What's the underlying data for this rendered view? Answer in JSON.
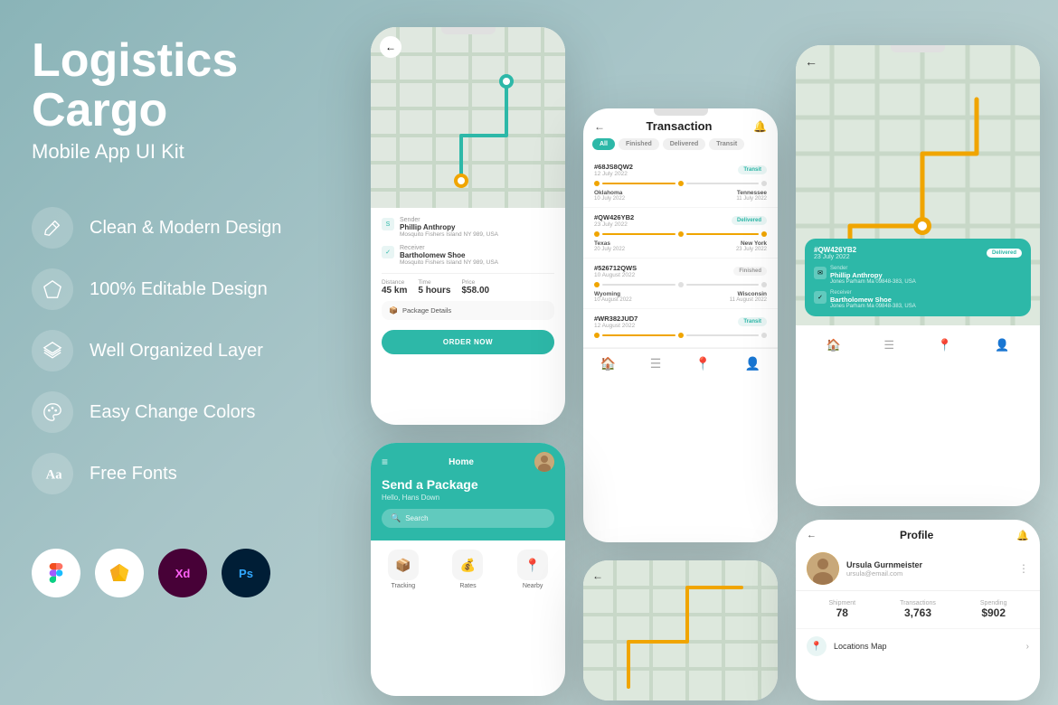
{
  "app": {
    "title": "Logistics",
    "title2": "Cargo",
    "subtitle": "Mobile App UI Kit"
  },
  "features": [
    {
      "id": "clean-design",
      "label": "Clean & Modern Design",
      "icon": "wand"
    },
    {
      "id": "editable",
      "label": "100% Editable Design",
      "icon": "diamond"
    },
    {
      "id": "layers",
      "label": "Well Organized Layer",
      "icon": "layers"
    },
    {
      "id": "colors",
      "label": "Easy Change Colors",
      "icon": "palette"
    },
    {
      "id": "fonts",
      "label": "Free Fonts",
      "icon": "text"
    }
  ],
  "tools": [
    {
      "name": "Figma",
      "label": "F",
      "bg": "#fff"
    },
    {
      "name": "Sketch",
      "label": "S",
      "bg": "#fff"
    },
    {
      "name": "XD",
      "label": "Xd",
      "bg": "#ff2bc2"
    },
    {
      "name": "Photoshop",
      "label": "Ps",
      "bg": "#001e36"
    }
  ],
  "phone1": {
    "back": "←",
    "sender_label": "Sender",
    "sender_name": "Phillip Anthropy",
    "sender_addr": "Mosquito Fishers Island NY 989, USA",
    "receiver_label": "Receiver",
    "receiver_name": "Bartholomew Shoe",
    "receiver_addr": "Mosquito Fishers Island NY 989, USA",
    "distance_label": "Distance",
    "distance_value": "45 km",
    "time_label": "Time",
    "time_value": "5 hours",
    "price_label": "Price",
    "price_value": "$58.00",
    "package_label": "Package Details",
    "order_btn": "ORDER NOW"
  },
  "phone2": {
    "title": "Transaction",
    "tabs": [
      "All",
      "Finished",
      "Delivered",
      "Transit"
    ],
    "transactions": [
      {
        "id": "#68JS8QW2",
        "date": "12 July 2022",
        "status": "Transit",
        "from": "Oklahoma",
        "from_date": "10 July 2022",
        "to": "Tennessee",
        "to_date": "11 July 2022",
        "progress": 0.5
      },
      {
        "id": "#QW426YB2",
        "date": "23 July 2022",
        "status": "Delivered",
        "from": "Texas",
        "from_date": "20 July 2022",
        "to": "New York",
        "to_date": "23 July 2022",
        "progress": 1
      },
      {
        "id": "#526712QWS",
        "date": "10 August 2022",
        "status": "Finished",
        "from": "Wyoming",
        "from_date": "10 August 2022",
        "to": "Wisconsin",
        "to_date": "11 August 2022",
        "progress": 0.3
      },
      {
        "id": "#WR382JUD7",
        "date": "12 August 2022",
        "status": "Transit",
        "from": "",
        "from_date": "",
        "to": "",
        "to_date": "",
        "progress": 0.7
      }
    ]
  },
  "phone3": {
    "back": "←",
    "card_id": "#QW426YB2",
    "card_date": "23 July 2022",
    "card_status": "Delivered",
    "sender_label": "Sender",
    "sender_name": "Phillip Anthropy",
    "sender_addr": "Jones Parham Ma 09848-383, USA",
    "receiver_label": "Receiver",
    "receiver_name": "Bartholomew Shoe",
    "receiver_addr": "Jones Parham Ma 09848-383, USA"
  },
  "phone4": {
    "home_label": "Home",
    "greeting": "Send a Package",
    "subtext": "Hello, Hans Down",
    "search_placeholder": "Search",
    "icons": [
      {
        "label": "Tracking",
        "icon": "📦"
      },
      {
        "label": "Rates",
        "icon": "💰"
      },
      {
        "label": "Nearby",
        "icon": "📍"
      }
    ]
  },
  "phone6": {
    "title": "Profile",
    "name": "Ursula Gurnmeister",
    "email": "ursula@email.com",
    "stats": [
      {
        "label": "Shipment",
        "value": "78"
      },
      {
        "label": "Transactions",
        "value": "3,763"
      },
      {
        "label": "Spending",
        "value": "$902"
      }
    ],
    "menu": [
      {
        "label": "Locations Map",
        "icon": "📍"
      }
    ]
  },
  "colors": {
    "primary": "#2db8a8",
    "accent": "#f0a500",
    "bg_gradient_start": "#8ab4b8",
    "bg_gradient_end": "#c5d8d8"
  }
}
